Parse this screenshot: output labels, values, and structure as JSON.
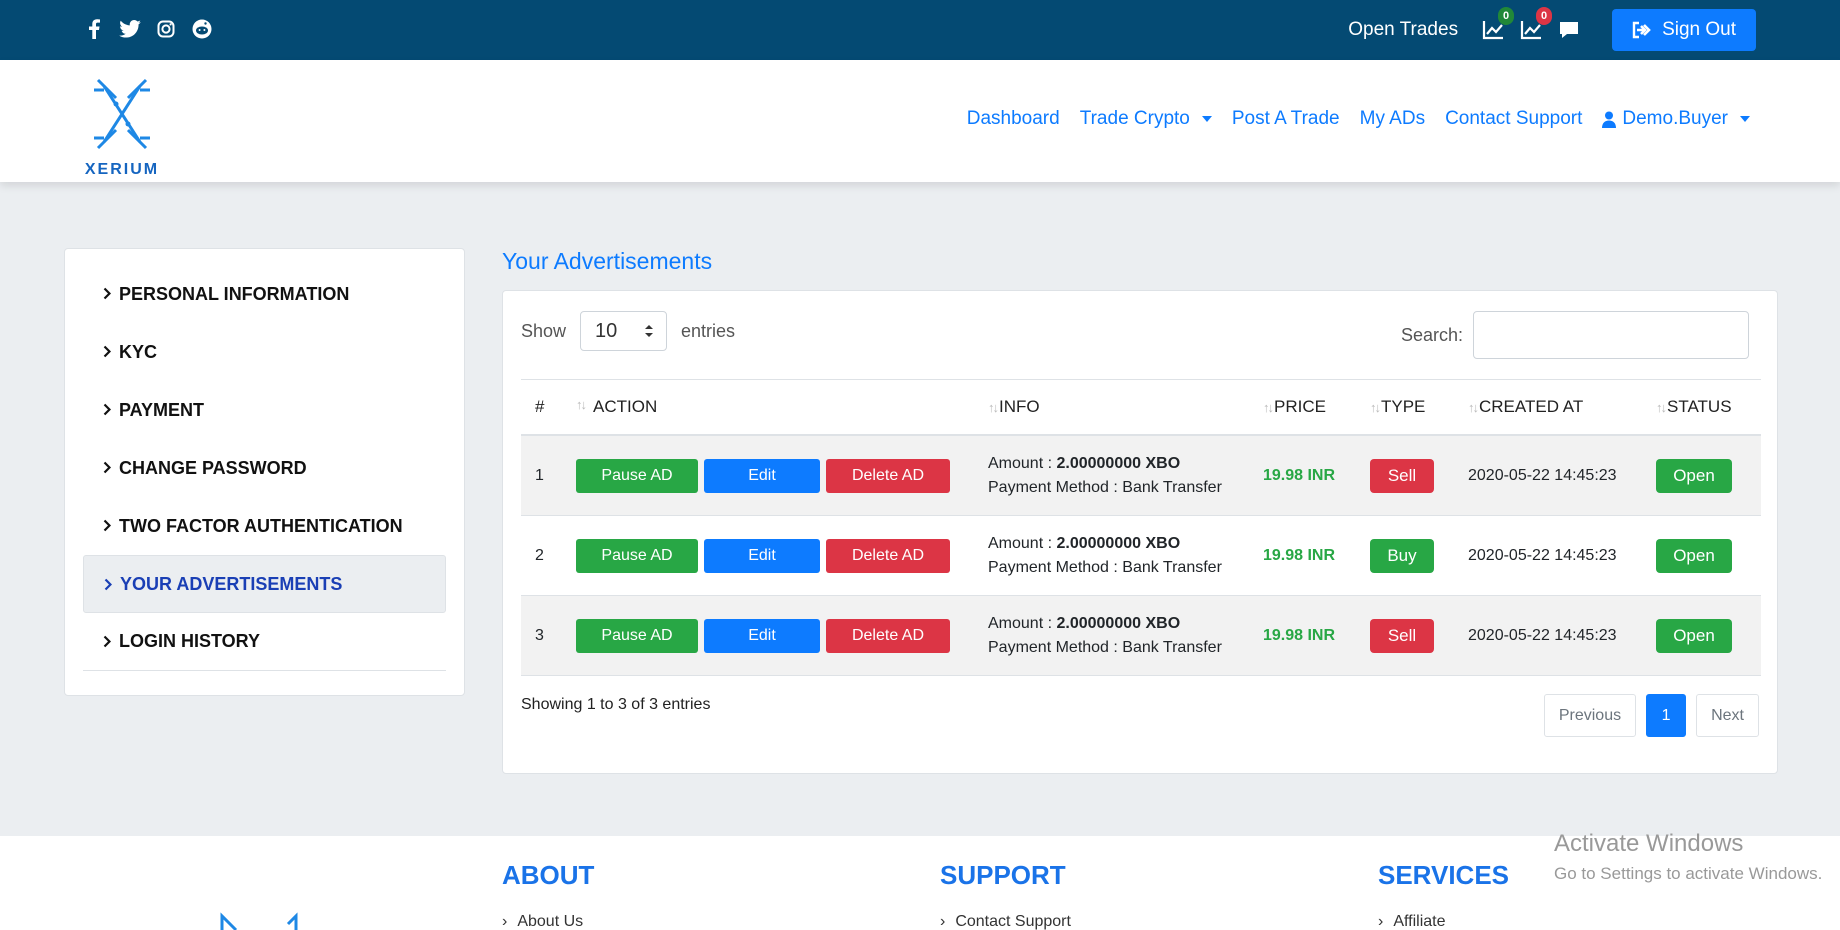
{
  "topbar": {
    "social_icons": [
      "facebook-icon",
      "twitter-icon",
      "instagram-icon",
      "reddit-icon"
    ],
    "open_trades_label": "Open Trades",
    "trade_icons": [
      {
        "name": "chart-icon",
        "badge": "0",
        "badge_color": "#218838"
      },
      {
        "name": "chart-icon",
        "badge": "0",
        "badge_color": "#dc3545"
      }
    ],
    "chat_icon": "chat-icon",
    "signout_label": "Sign Out",
    "background": "#044a73"
  },
  "header": {
    "logo_text": "XERIUM",
    "nav": {
      "dashboard": "Dashboard",
      "trade_crypto": "Trade Crypto",
      "post_trade": "Post A Trade",
      "my_ads": "My ADs",
      "contact_support": "Contact Support",
      "user": "Demo.Buyer"
    }
  },
  "sidebar": {
    "items": [
      {
        "label": "PERSONAL INFORMATION"
      },
      {
        "label": "KYC"
      },
      {
        "label": "PAYMENT"
      },
      {
        "label": "CHANGE PASSWORD"
      },
      {
        "label": "TWO FACTOR AUTHENTICATION"
      },
      {
        "label": "YOUR ADVERTISEMENTS"
      },
      {
        "label": "LOGIN HISTORY"
      }
    ]
  },
  "main": {
    "title": "Your Advertisements",
    "show_label": "Show",
    "entries_value": "10",
    "entries_label": "entries",
    "search_label": "Search:",
    "columns": [
      "#",
      "ACTION",
      "INFO",
      "PRICE",
      "TYPE",
      "CREATED AT",
      "STATUS"
    ],
    "buttons": {
      "pause": "Pause AD",
      "edit": "Edit",
      "delete": "Delete AD"
    },
    "rows": [
      {
        "num": "1",
        "amount_label": "Amount :",
        "amount": "2.00000000 XBO",
        "payment_label": "Payment Method :",
        "payment": "Bank Transfer",
        "price": "19.98 INR",
        "type": "Sell",
        "created": "2020-05-22 14:45:23",
        "status": "Open"
      },
      {
        "num": "2",
        "amount_label": "Amount :",
        "amount": "2.00000000 XBO",
        "payment_label": "Payment Method :",
        "payment": "Bank Transfer",
        "price": "19.98 INR",
        "type": "Buy",
        "created": "2020-05-22 14:45:23",
        "status": "Open"
      },
      {
        "num": "3",
        "amount_label": "Amount :",
        "amount": "2.00000000 XBO",
        "payment_label": "Payment Method :",
        "payment": "Bank Transfer",
        "price": "19.98 INR",
        "type": "Sell",
        "created": "2020-05-22 14:45:23",
        "status": "Open"
      }
    ],
    "showing_text": "Showing 1 to 3 of 3 entries",
    "pager": {
      "previous": "Previous",
      "current": "1",
      "next": "Next"
    }
  },
  "footer": {
    "about": {
      "title": "ABOUT",
      "link": "About Us"
    },
    "support": {
      "title": "SUPPORT",
      "link": "Contact Support"
    },
    "services": {
      "title": "SERVICES",
      "link": "Affiliate"
    }
  },
  "watermark": {
    "line1": "Activate Windows",
    "line2": "Go to Settings to activate Windows."
  }
}
